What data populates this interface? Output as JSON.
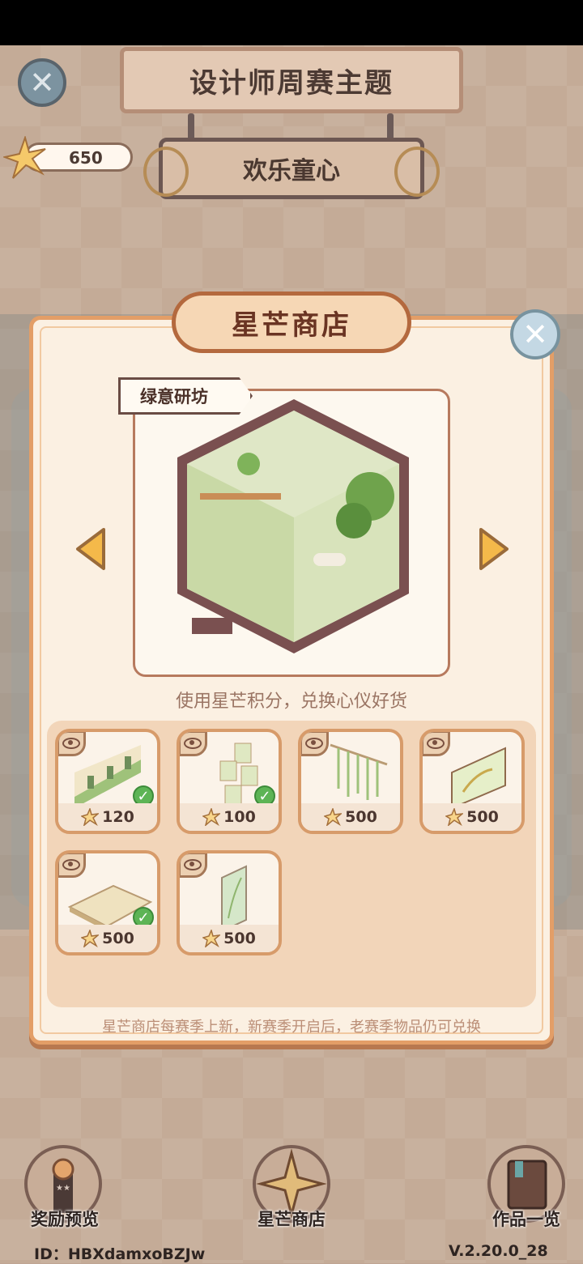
{
  "header": {
    "title": "设计师周赛主题",
    "theme_name": "欢乐童心",
    "star_points": "650"
  },
  "shop": {
    "title": "星芒商店",
    "featured_item": "绿意研坊",
    "subtitle": "使用星芒积分，兑换心仪好货",
    "footer_note": "星芒商店每赛季上新，新赛季开启后，老赛季物品仍可兑换",
    "items": [
      {
        "price": "120",
        "owned": true
      },
      {
        "price": "100",
        "owned": true
      },
      {
        "price": "500",
        "owned": false
      },
      {
        "price": "500",
        "owned": false
      },
      {
        "price": "500",
        "owned": true
      },
      {
        "price": "500",
        "owned": false
      }
    ]
  },
  "bottom_nav": {
    "rewards_label": "奖励预览",
    "shop_label": "星芒商店",
    "works_label": "作品一览"
  },
  "footer": {
    "user_id": "ID：HBXdamxoBZJw",
    "version": "V.2.20.0_28"
  },
  "colors": {
    "panel_border": "#e39e67",
    "banner_text": "#6a3423",
    "owned_check": "#5db455"
  }
}
